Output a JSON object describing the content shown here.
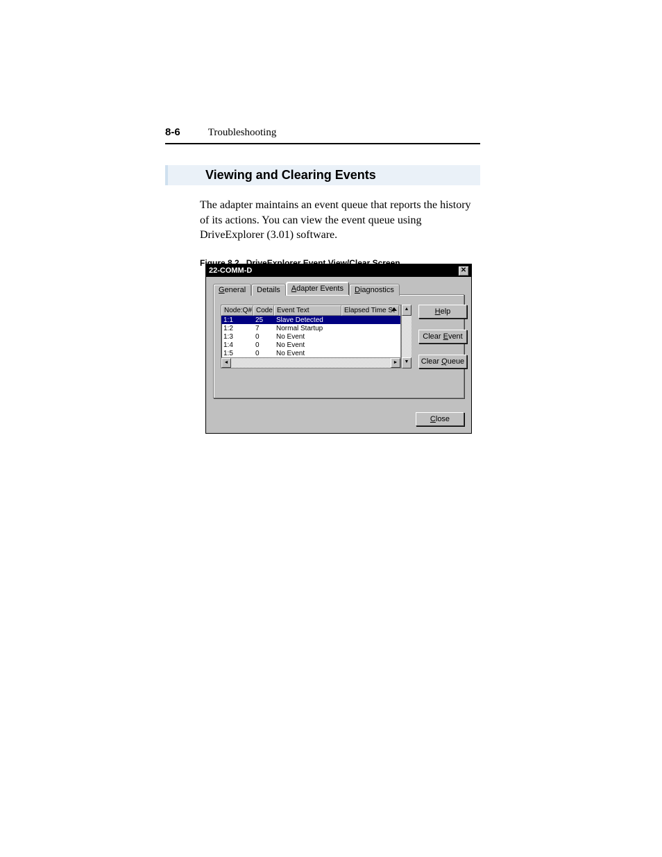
{
  "header": {
    "page_number": "8-6",
    "chapter": "Troubleshooting"
  },
  "section": {
    "heading": "Viewing and Clearing Events",
    "body": "The adapter maintains an event queue that reports the history of its actions. You can view the event queue using DriveExplorer (3.01) software."
  },
  "figure": {
    "caption_label": "Figure 8.2",
    "caption_text": "DriveExplorer Event View/Clear Screen"
  },
  "dialog": {
    "title": "22-COMM-D",
    "tabs": {
      "general_pre": "G",
      "general_rest": "eneral",
      "details": "Details",
      "adapter_pre": "A",
      "adapter_rest": "dapter Events",
      "diag_pre": "D",
      "diag_rest": "iagnostics"
    },
    "grid": {
      "headers": {
        "node": "Node:Q#",
        "code": "Code",
        "text": "Event Text",
        "time": "Elapsed Time St"
      },
      "rows": [
        {
          "node": "1:1",
          "code": "25",
          "text": "Slave Detected",
          "selected": true
        },
        {
          "node": "1:2",
          "code": "7",
          "text": "Normal Startup",
          "selected": false
        },
        {
          "node": "1:3",
          "code": "0",
          "text": "No Event",
          "selected": false
        },
        {
          "node": "1:4",
          "code": "0",
          "text": "No Event",
          "selected": false
        },
        {
          "node": "1:5",
          "code": "0",
          "text": "No Event",
          "selected": false
        }
      ]
    },
    "buttons": {
      "help_pre": "H",
      "help_rest": "elp",
      "clear_event_pre": "Clear ",
      "clear_event_u": "E",
      "clear_event_post": "vent",
      "clear_queue_pre": "Clear ",
      "clear_queue_u": "Q",
      "clear_queue_post": "ueue",
      "close_u": "C",
      "close_rest": "lose"
    }
  }
}
